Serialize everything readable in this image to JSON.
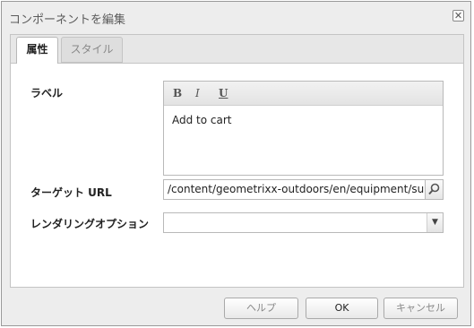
{
  "dialog": {
    "title": "コンポーネントを編集",
    "close_symbol": "✕"
  },
  "tabs": [
    {
      "label": "属性",
      "active": true
    },
    {
      "label": "スタイル",
      "active": false
    }
  ],
  "fields": {
    "label": {
      "label": "ラベル",
      "toolbar": {
        "bold": "B",
        "italic": "I",
        "underline": "U"
      },
      "value": "Add to cart"
    },
    "target_url": {
      "label": "ターゲット URL",
      "value": "/content/geometrixx-outdoors/en/equipment/surf",
      "browse_icon": "search-icon"
    },
    "rendering_option": {
      "label": "レンダリングオプション",
      "value": ""
    }
  },
  "buttons": {
    "help": "ヘルプ",
    "ok": "OK",
    "cancel": "キャンセル"
  }
}
